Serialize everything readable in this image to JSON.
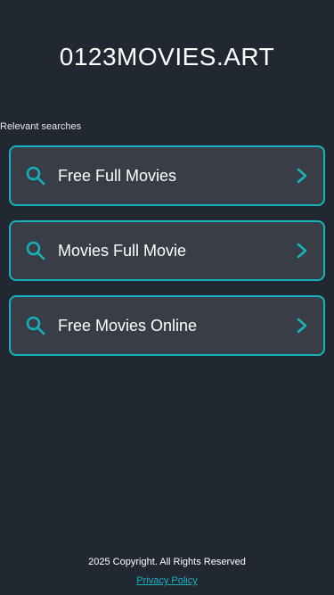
{
  "header": {
    "site_title": "0123MOVIES.ART"
  },
  "main": {
    "section_label": "Relevant searches",
    "search_items": [
      {
        "label": "Free Full Movies",
        "icon": "search-icon",
        "trailing_icon": "chevron-right-icon"
      },
      {
        "label": "Movies Full Movie",
        "icon": "search-icon",
        "trailing_icon": "chevron-right-icon"
      },
      {
        "label": "Free Movies Online",
        "icon": "search-icon",
        "trailing_icon": "chevron-right-icon"
      }
    ]
  },
  "footer": {
    "copyright": "2025 Copyright. All Rights Reserved",
    "privacy_link": "Privacy Policy"
  },
  "colors": {
    "background": "#222831",
    "card": "#393e46",
    "accent": "#16b3be",
    "text": "#ffffff"
  }
}
